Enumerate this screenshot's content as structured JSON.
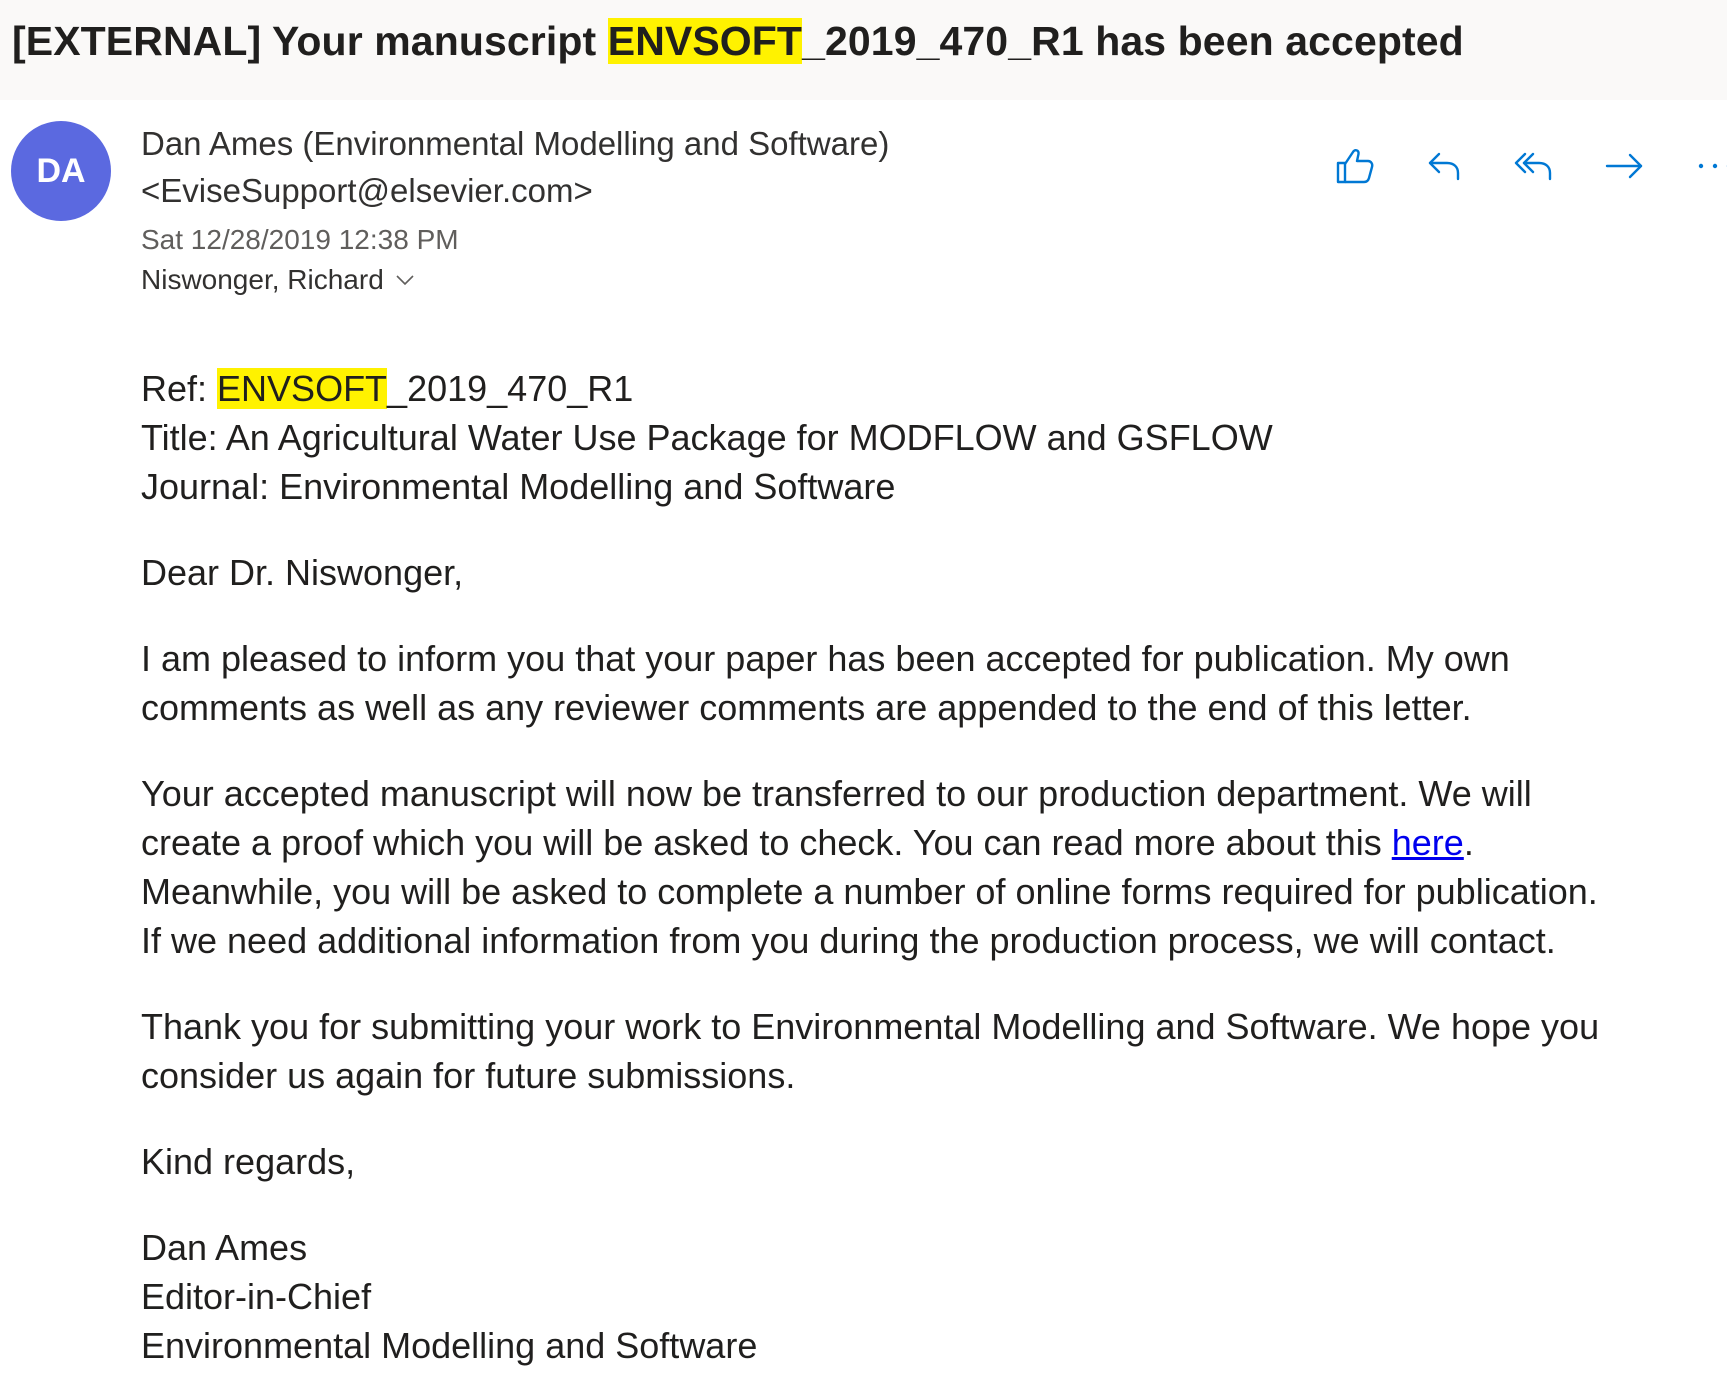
{
  "subject": {
    "prefix": "[EXTERNAL] Your manuscript ",
    "highlight": "ENVSOFT",
    "suffix": "_2019_470_R1 has been accepted"
  },
  "sender": {
    "initials": "DA",
    "avatar_color": "#5b69e0",
    "name": "Dan Ames (Environmental Modelling and Software)",
    "email": "<EviseSupport@elsevier.com>",
    "date": "Sat 12/28/2019 12:38 PM",
    "to": "Niswonger, Richard"
  },
  "actions": [
    {
      "name": "like-button",
      "icon": "thumbs-up-icon"
    },
    {
      "name": "reply-button",
      "icon": "reply-icon"
    },
    {
      "name": "reply-all-button",
      "icon": "reply-all-icon"
    },
    {
      "name": "forward-button",
      "icon": "forward-icon"
    },
    {
      "name": "more-actions-button",
      "icon": "more-icon"
    }
  ],
  "accent_color": "#0078d4",
  "highlight_color": "#fff200",
  "body": {
    "ref_label": "Ref: ",
    "ref_highlight": "ENVSOFT",
    "ref_rest": "_2019_470_R1",
    "title_line": "Title: An Agricultural Water Use Package for MODFLOW and GSFLOW",
    "journal_line": "Journal: Environmental Modelling and Software",
    "greeting": "Dear Dr. Niswonger,",
    "para1_line1": "I am pleased to inform you that your paper has been accepted for publication. My own",
    "para1_line2": "comments as well as any reviewer comments are appended to the end of this letter.",
    "para2_line1": "Your accepted manuscript will now be transferred to our production department. We will",
    "para2_line2_before": "create a proof which you will be asked to check. You can read more about this ",
    "para2_link": "here",
    "para2_line2_after": ".",
    "para2_line3": "Meanwhile, you will be asked to complete a number of online forms required for publication.",
    "para2_line4": "If we need additional information from you during the production process, we will contact.",
    "para3_line1": "Thank you for submitting your work to Environmental Modelling and Software. We hope you",
    "para3_line2": "consider us again for future submissions.",
    "closing": "Kind regards,",
    "sig_name": "Dan Ames",
    "sig_title": "Editor-in-Chief",
    "sig_journal": "Environmental Modelling and Software"
  }
}
